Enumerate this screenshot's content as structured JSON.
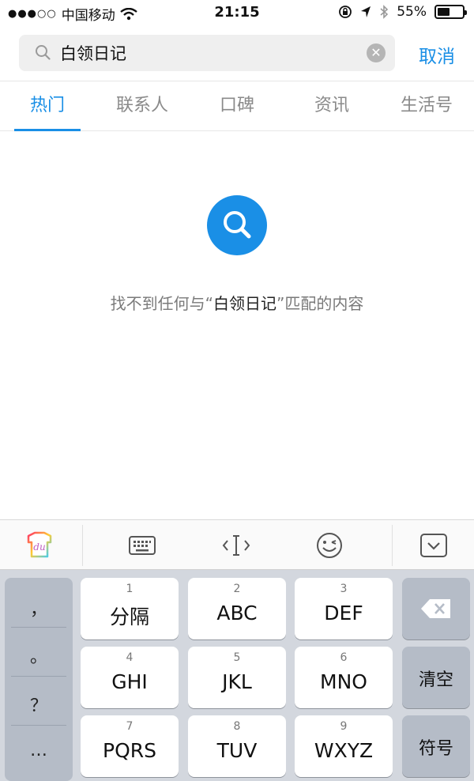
{
  "status_bar": {
    "carrier": "中国移动",
    "time": "21:15",
    "battery": "55%",
    "battery_level": 0.55
  },
  "search": {
    "query": "白领日记",
    "cancel_label": "取消"
  },
  "tabs": [
    {
      "label": "热门",
      "active": true
    },
    {
      "label": "联系人",
      "active": false
    },
    {
      "label": "口碑",
      "active": false
    },
    {
      "label": "资讯",
      "active": false
    },
    {
      "label": "生活号",
      "active": false
    }
  ],
  "empty": {
    "prefix": "找不到任何与“",
    "query": "白领日记",
    "suffix": "”匹配的内容"
  },
  "keyboard": {
    "left_column": [
      "，",
      "。",
      "？",
      "…"
    ],
    "keys": [
      {
        "num": "1",
        "label": "分隔"
      },
      {
        "num": "2",
        "label": "ABC"
      },
      {
        "num": "3",
        "label": "DEF"
      },
      {
        "num": "4",
        "label": "GHI"
      },
      {
        "num": "5",
        "label": "JKL"
      },
      {
        "num": "6",
        "label": "MNO"
      },
      {
        "num": "7",
        "label": "PQRS"
      },
      {
        "num": "8",
        "label": "TUV"
      },
      {
        "num": "9",
        "label": "WXYZ"
      }
    ],
    "clear_label": "清空",
    "symbol_label": "符号"
  },
  "colors": {
    "accent": "#1a8fe6",
    "keyboard_bg": "#d3d7de"
  },
  "icons": [
    "search-icon",
    "clear-icon",
    "keyboard-icon",
    "cursor-icon",
    "emoji-icon",
    "collapse-icon",
    "backspace-icon",
    "wifi-icon",
    "location-icon",
    "bluetooth-icon"
  ]
}
